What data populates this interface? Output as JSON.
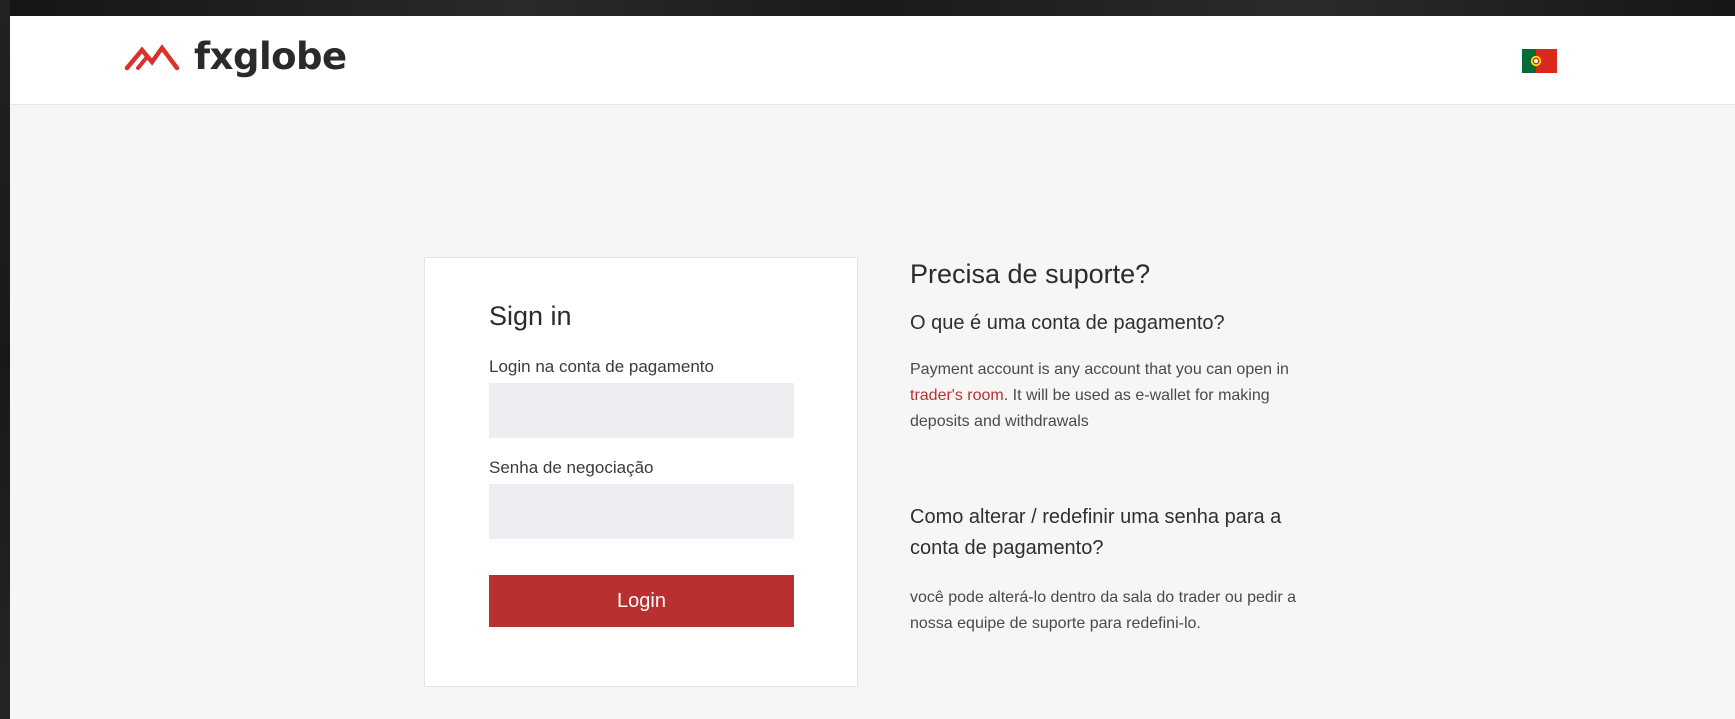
{
  "header": {
    "logo_text": "fxglobe",
    "language_flag": "portugal-flag-icon"
  },
  "signin": {
    "title": "Sign in",
    "login_label": "Login na conta de pagamento",
    "login_value": "",
    "password_label": "Senha de negociação",
    "password_value": "",
    "button_label": "Login"
  },
  "support": {
    "title": "Precisa de suporte?",
    "q1": "O que é uma conta de pagamento?",
    "a1_before": "Payment account is any account that you can open in ",
    "a1_link": "trader's room",
    "a1_after": ". It will be used as e-wallet for making deposits and withdrawals",
    "q2": "Como alterar / redefinir uma senha para a conta de pagamento?",
    "a2": "você pode alterá-lo dentro da sala do trader ou pedir a nossa equipe de suporte para redefini-lo."
  },
  "colors": {
    "brand_red": "#b93030",
    "header_bg": "#ffffff",
    "page_bg": "#f6f6f6",
    "input_bg": "#eceef1"
  }
}
